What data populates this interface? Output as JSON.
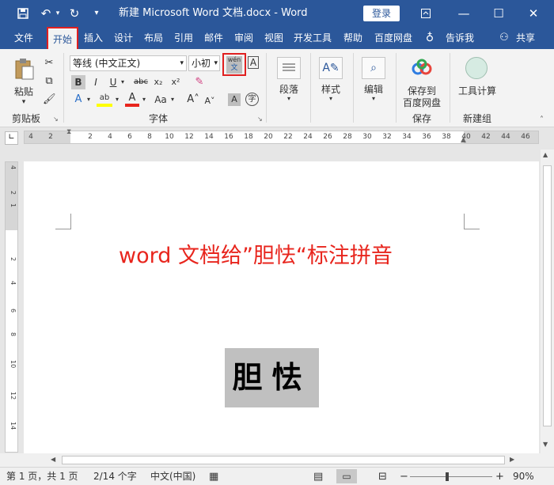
{
  "window": {
    "title": "新建 Microsoft Word 文档.docx  -  Word",
    "login": "登录"
  },
  "quick_access": {
    "save": "save-icon",
    "undo": "undo-icon",
    "redo": "redo-icon",
    "customize": "▾"
  },
  "menu": {
    "tabs": [
      "文件",
      "开始",
      "插入",
      "设计",
      "布局",
      "引用",
      "邮件",
      "审阅",
      "视图",
      "开发工具",
      "帮助",
      "百度网盘"
    ],
    "selected": "开始",
    "tell": "告诉我",
    "share": "共享"
  },
  "ribbon": {
    "clipboard": {
      "paste": "粘贴",
      "label": "剪贴板"
    },
    "font": {
      "name": "等线 (中文正文)",
      "size": "小初",
      "label": "字体",
      "phonetic_top": "wén",
      "phonetic_bottom": "文"
    },
    "paragraph": {
      "label": "段落"
    },
    "styles": {
      "label": "样式"
    },
    "editing": {
      "label": "编辑"
    },
    "save_baidu": {
      "label1": "保存到",
      "label2": "百度网盘",
      "group": "保存"
    },
    "calc": {
      "label": "工具计算",
      "group": "新建组"
    }
  },
  "ruler": {
    "ticks": [
      "4",
      "2",
      "2",
      "4",
      "6",
      "8",
      "10",
      "12",
      "14",
      "16",
      "18",
      "20",
      "22",
      "24",
      "26",
      "28",
      "30",
      "32",
      "34",
      "36",
      "38",
      "40",
      "42",
      "44",
      "46"
    ],
    "vticks": [
      "4",
      "2",
      "1",
      "2",
      "4",
      "6",
      "8",
      "10",
      "12",
      "14"
    ]
  },
  "document": {
    "heading": "word 文档给”胆怯“标注拼音",
    "chars": "胆怯"
  },
  "status": {
    "page": "第 1 页，共 1 页",
    "words": "2/14 个字",
    "lang": "中文(中国)",
    "zoom": "90%"
  },
  "colors": {
    "accent": "#2b579a",
    "heading": "#e8251d",
    "highlight": "#e02020"
  }
}
